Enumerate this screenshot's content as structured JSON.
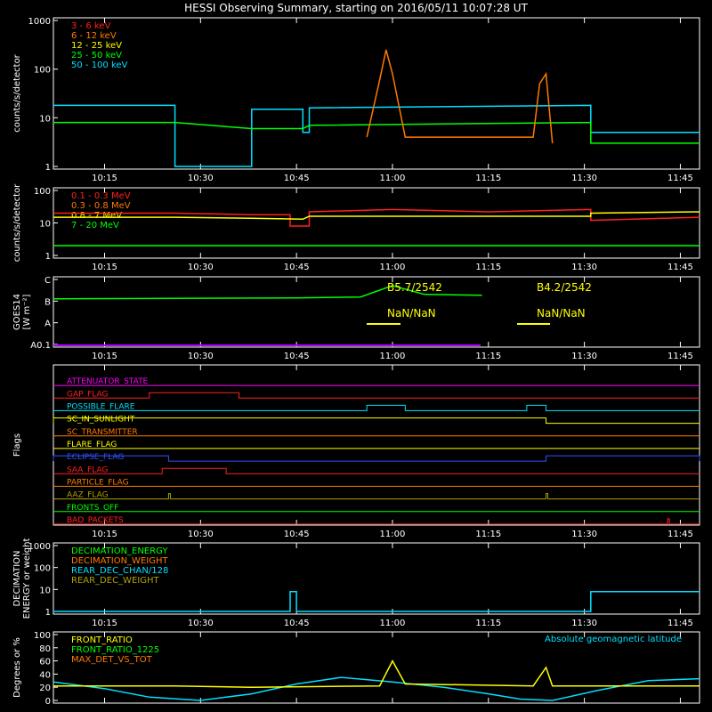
{
  "title": "HESSI Observing Summary, starting on 2016/05/11 10:07:28 UT",
  "time_ticks": [
    "10:15",
    "10:30",
    "10:45",
    "11:00",
    "11:15",
    "11:30",
    "11:45"
  ],
  "colors": {
    "red": "#ff2020",
    "orange": "#ff7a00",
    "yellow": "#ffff00",
    "green": "#00ff00",
    "cyan": "#00e0ff",
    "magenta": "#ff00ff",
    "blue": "#3050ff",
    "brown": "#c08040",
    "olive": "#b0a000",
    "violet": "#b000ff"
  },
  "chart_data": [
    {
      "type": "line",
      "name": "count-rates-low",
      "ylabel": "counts/s/detector",
      "yscale": "log",
      "ylim": [
        1,
        1000
      ],
      "ytick_labels": [
        "1",
        "10",
        "100",
        "1000"
      ],
      "series": [
        {
          "name": "3 - 6 keV",
          "color": "#ff2020"
        },
        {
          "name": "6 - 12 keV",
          "color": "#ff7a00"
        },
        {
          "name": "12 - 25 keV",
          "color": "#ffff00"
        },
        {
          "name": "25 - 50 keV",
          "color": "#00ff00"
        },
        {
          "name": "50 - 100 keV",
          "color": "#00e0ff"
        }
      ],
      "x_start": "10:07",
      "x_end": "11:48",
      "segments": [
        {
          "series": "50 - 100 keV",
          "points": [
            [
              "10:07",
              18
            ],
            [
              "10:26",
              18
            ],
            [
              "10:26",
              1
            ],
            [
              "10:38",
              1
            ],
            [
              "10:38",
              15
            ],
            [
              "10:46",
              15
            ],
            [
              "10:46",
              5
            ],
            [
              "10:47",
              5
            ],
            [
              "10:47",
              16
            ],
            [
              "11:31",
              18
            ],
            [
              "11:31",
              5
            ],
            [
              "11:48",
              5
            ]
          ]
        },
        {
          "series": "25 - 50 keV",
          "points": [
            [
              "10:07",
              8
            ],
            [
              "10:26",
              8
            ],
            [
              "10:38",
              6
            ],
            [
              "10:46",
              6
            ],
            [
              "10:47",
              7
            ],
            [
              "11:31",
              8
            ],
            [
              "11:31",
              3
            ],
            [
              "11:48",
              3
            ]
          ]
        },
        {
          "series": "6 - 12 keV",
          "points": [
            [
              "10:56",
              4
            ],
            [
              "10:58",
              60
            ],
            [
              "10:59",
              250
            ],
            [
              "11:00",
              80
            ],
            [
              "11:02",
              4
            ],
            [
              "11:22",
              4
            ],
            [
              "11:23",
              50
            ],
            [
              "11:24",
              80
            ],
            [
              "11:25",
              3
            ]
          ]
        }
      ]
    },
    {
      "type": "line",
      "name": "count-rates-high",
      "ylabel": "counts/s/detector",
      "yscale": "log",
      "ylim": [
        1,
        100
      ],
      "ytick_labels": [
        "1",
        "10",
        "100"
      ],
      "series": [
        {
          "name": "0.1 - 0.3 MeV",
          "color": "#ff2020"
        },
        {
          "name": "0.3 - 0.8 MeV",
          "color": "#ff7a00"
        },
        {
          "name": "0.8 - 7 MeV",
          "color": "#ffff00"
        },
        {
          "name": "7 - 20 MeV",
          "color": "#00ff00"
        }
      ],
      "segments": [
        {
          "series": "0.1 - 0.3 MeV",
          "points": [
            [
              "10:07",
              20
            ],
            [
              "10:26",
              20
            ],
            [
              "10:38",
              18
            ],
            [
              "10:44",
              18
            ],
            [
              "10:44",
              8
            ],
            [
              "10:47",
              8
            ],
            [
              "10:47",
              22
            ],
            [
              "11:00",
              26
            ],
            [
              "11:15",
              22
            ],
            [
              "11:31",
              26
            ],
            [
              "11:31",
              12
            ],
            [
              "11:48",
              15
            ]
          ]
        },
        {
          "series": "0.8 - 7 MeV",
          "points": [
            [
              "10:07",
              15
            ],
            [
              "10:26",
              15
            ],
            [
              "10:38",
              14
            ],
            [
              "10:46",
              13
            ],
            [
              "10:47",
              16
            ],
            [
              "11:31",
              16
            ],
            [
              "11:31",
              20
            ],
            [
              "11:48",
              22
            ]
          ]
        },
        {
          "series": "7 - 20 MeV",
          "points": [
            [
              "10:07",
              2
            ],
            [
              "10:26",
              2
            ],
            [
              "10:38",
              2
            ],
            [
              "11:48",
              2
            ]
          ]
        }
      ]
    },
    {
      "type": "line",
      "name": "goes",
      "ylabel": "GOES14",
      "ylabel2": "[W m⁻²]",
      "ytick_labels": [
        "A0.1",
        "A",
        "B",
        "C"
      ],
      "annotations": [
        "B5.7/2542",
        "B4.2/2542",
        "NaN/NaN",
        "NaN/NaN"
      ],
      "segments": [
        {
          "series": "goes",
          "color": "#00ff00",
          "points": [
            [
              "10:07",
              5.5
            ],
            [
              "10:45",
              5.6
            ],
            [
              "10:55",
              5.7
            ],
            [
              "11:00",
              7.0
            ],
            [
              "11:05",
              6.0
            ],
            [
              "11:14",
              5.9
            ]
          ]
        }
      ]
    },
    {
      "type": "flags",
      "name": "flags",
      "ylabel": "Flags",
      "flags": [
        {
          "name": "ATTENUATOR_STATE",
          "color": "#ff00ff",
          "steps": []
        },
        {
          "name": "GAP_FLAG",
          "color": "#ff2020",
          "steps": [
            [
              "10:22",
              "10:36"
            ]
          ]
        },
        {
          "name": "POSSIBLE_FLARE",
          "color": "#00e0ff",
          "steps": [
            [
              "10:56",
              "11:02"
            ],
            [
              "11:21",
              "11:24"
            ]
          ]
        },
        {
          "name": "SC_IN_SUNLIGHT",
          "color": "#ffff00",
          "steps": [
            [
              "10:07",
              "11:24"
            ]
          ]
        },
        {
          "name": "SC_TRANSMITTER",
          "color": "#ff7a00",
          "steps": []
        },
        {
          "name": "FLARE_FLAG",
          "color": "#ffff00",
          "steps": []
        },
        {
          "name": "ECLIPSE_FLAG",
          "color": "#3050ff",
          "steps": [
            [
              "10:07",
              "10:25"
            ],
            [
              "11:24",
              "11:48"
            ]
          ]
        },
        {
          "name": "SAA_FLAG",
          "color": "#ff2020",
          "steps": [
            [
              "10:24",
              "10:34"
            ]
          ]
        },
        {
          "name": "PARTICLE_FLAG",
          "color": "#ff7a00",
          "steps": []
        },
        {
          "name": "AAZ_FLAG",
          "color": "#b0a000",
          "steps": [
            [
              "10:25",
              "10:25"
            ],
            [
              "11:24",
              "11:24"
            ]
          ]
        },
        {
          "name": "FRONTS_OFF",
          "color": "#00ff00",
          "steps": []
        },
        {
          "name": "BAD_PACKETS",
          "color": "#ff2020",
          "steps": [
            [
              "11:43",
              "11:43"
            ]
          ]
        }
      ]
    },
    {
      "type": "line",
      "name": "decimation",
      "ylabel": "DECIMATION",
      "ylabel2": "ENERGY or weight",
      "yscale": "log",
      "ylim": [
        1,
        1000
      ],
      "ytick_labels": [
        "1",
        "10",
        "100",
        "1000"
      ],
      "series": [
        {
          "name": "DECIMATION_ENERGY",
          "color": "#00ff00"
        },
        {
          "name": "DECIMATION_WEIGHT",
          "color": "#ff7a00"
        },
        {
          "name": "REAR_DEC_CHAN/128",
          "color": "#00e0ff"
        },
        {
          "name": "REAR_DEC_WEIGHT",
          "color": "#b0a000"
        }
      ],
      "segments": [
        {
          "series": "REAR_DEC_CHAN/128",
          "points": [
            [
              "10:07",
              1
            ],
            [
              "10:44",
              1
            ],
            [
              "10:44",
              8
            ],
            [
              "10:45",
              8
            ],
            [
              "10:45",
              1
            ],
            [
              "11:31",
              1
            ],
            [
              "11:31",
              8
            ],
            [
              "11:48",
              8
            ]
          ]
        }
      ]
    },
    {
      "type": "line",
      "name": "ratios",
      "ylabel": "Degrees or %",
      "ylim": [
        0,
        100
      ],
      "ytick_labels": [
        "0",
        "20",
        "40",
        "60",
        "80",
        "100"
      ],
      "series": [
        {
          "name": "FRONT_RATIO",
          "color": "#ffff00"
        },
        {
          "name": "FRONT_RATIO_1225",
          "color": "#00ff00"
        },
        {
          "name": "MAX_DET_VS_TOT",
          "color": "#ff7a00"
        }
      ],
      "annotation": "Absolute geomagnetic latitude",
      "segments": [
        {
          "series": "latitude",
          "color": "#00e0ff",
          "points": [
            [
              "10:07",
              28
            ],
            [
              "10:15",
              18
            ],
            [
              "10:22",
              5
            ],
            [
              "10:30",
              0
            ],
            [
              "10:38",
              10
            ],
            [
              "10:45",
              25
            ],
            [
              "10:52",
              35
            ],
            [
              "11:00",
              28
            ],
            [
              "11:08",
              20
            ],
            [
              "11:15",
              10
            ],
            [
              "11:20",
              2
            ],
            [
              "11:25",
              0
            ],
            [
              "11:32",
              15
            ],
            [
              "11:40",
              30
            ],
            [
              "11:48",
              33
            ]
          ]
        },
        {
          "series": "FRONT_RATIO",
          "points": [
            [
              "10:07",
              22
            ],
            [
              "10:26",
              22
            ],
            [
              "10:38",
              20
            ],
            [
              "10:58",
              22
            ],
            [
              "11:00",
              60
            ],
            [
              "11:02",
              25
            ],
            [
              "11:22",
              22
            ],
            [
              "11:24",
              50
            ],
            [
              "11:25",
              22
            ],
            [
              "11:48",
              22
            ]
          ]
        }
      ]
    }
  ]
}
